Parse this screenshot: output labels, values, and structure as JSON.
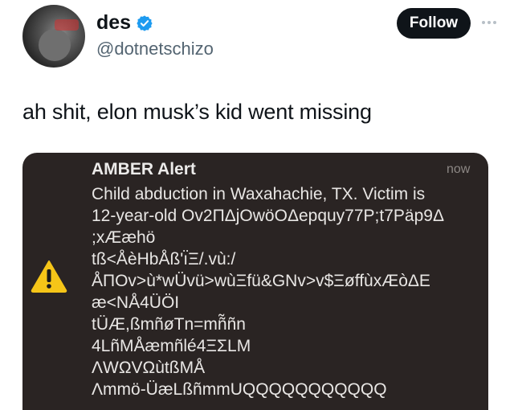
{
  "header": {
    "display_name": "des",
    "handle": "@dotnetschizo",
    "follow_label": "Follow",
    "verified_icon": "verified-badge-icon",
    "more_icon": "more-options-icon"
  },
  "tweet": {
    "text": "ah shit, elon musk’s kid went missing"
  },
  "alert": {
    "title": "AMBER Alert",
    "time": "now",
    "icon": "warning-icon",
    "lines": [
      "Child abduction in Waxahachie, TX. Victim is",
      "12-year-old Ov2ΠΔjOwöOΔepquy77P;t7Päp9Δ",
      ";xÆæhö",
      "tß<ÅèHbÅß'ı̈Ξ/.vù:/",
      "ÅПOv>ù*wÜvü>wùΞfü&GNv>v$ΞøffùxÆòΔE",
      "æ<NÅ4ÜÖI",
      "tÜÆ,ßmñøTn=mñ̃ñn",
      "4LñMÅæmñlé4ΞΣLM",
      "ΛWΩVΩùtßMÅ",
      "Λmmö-ÜæLßñmmUQQQQQQQQQQQ"
    ]
  },
  "colors": {
    "follow_bg": "#0f1419",
    "handle": "#536471",
    "alert_bg": "#2a2423",
    "warning": "#f5c518",
    "verified": "#1d9bf0"
  }
}
